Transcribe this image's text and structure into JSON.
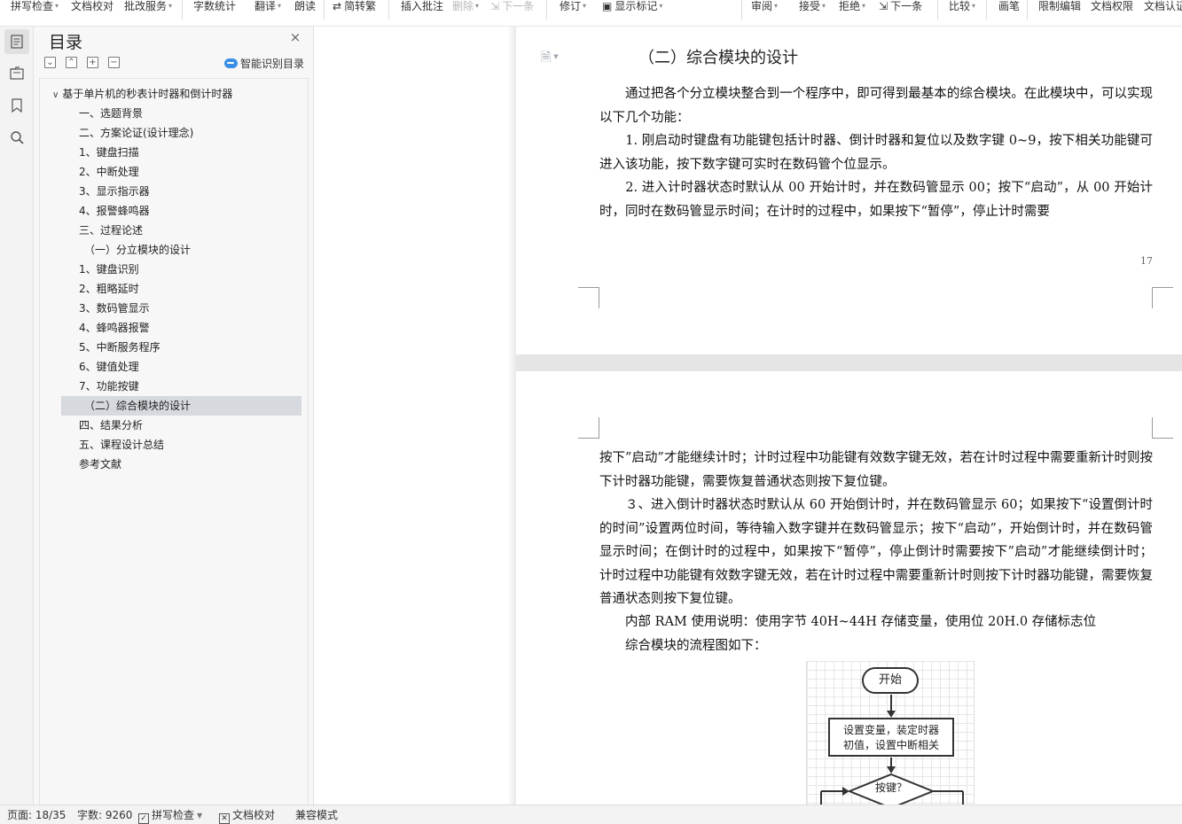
{
  "toolbar": {
    "items": [
      {
        "label": "拼写检查",
        "dropdown": true,
        "disabled": false
      },
      {
        "label": "文档校对",
        "dropdown": false,
        "disabled": false
      },
      {
        "label": "批改服务",
        "dropdown": true,
        "disabled": false
      },
      {
        "label": "字数统计",
        "dropdown": false,
        "disabled": false
      },
      {
        "label": "翻译",
        "dropdown": true,
        "disabled": false
      },
      {
        "label": "朗读",
        "dropdown": false,
        "disabled": false
      },
      {
        "label": "简转繁",
        "dropdown": false,
        "disabled": false,
        "icon": "convert-icon"
      },
      {
        "label": "插入批注",
        "dropdown": false,
        "disabled": false
      },
      {
        "label": "删除",
        "dropdown": true,
        "disabled": true
      },
      {
        "label": "下一条",
        "dropdown": false,
        "disabled": true,
        "icon": "next-comment-icon"
      },
      {
        "label": "修订",
        "dropdown": true,
        "disabled": false
      },
      {
        "label": "显示标记",
        "dropdown": true,
        "disabled": false,
        "icon": "show-markup-icon"
      },
      {
        "label": "审阅",
        "dropdown": true,
        "disabled": false
      },
      {
        "label": "接受",
        "dropdown": true,
        "disabled": false
      },
      {
        "label": "拒绝",
        "dropdown": true,
        "disabled": false
      },
      {
        "label": "下一条",
        "dropdown": false,
        "disabled": false,
        "icon": "next-change-icon"
      },
      {
        "label": "比较",
        "dropdown": true,
        "disabled": false
      },
      {
        "label": "画笔",
        "dropdown": false,
        "disabled": false
      },
      {
        "label": "限制编辑",
        "dropdown": false,
        "disabled": false
      },
      {
        "label": "文档权限",
        "dropdown": false,
        "disabled": false
      },
      {
        "label": "文档认证",
        "dropdown": false,
        "disabled": false
      }
    ]
  },
  "rail": {
    "icons": [
      "toc-icon",
      "navigation-icon",
      "bookmark-icon",
      "search-icon"
    ]
  },
  "toc": {
    "title": "目录",
    "smart_label": "智能识别目录",
    "tool_icons": [
      "collapse-icon",
      "expand-icon",
      "add-level-icon",
      "remove-level-icon"
    ],
    "root": "基于单片机的秒表计时器和倒计时器",
    "items": [
      {
        "label": "一、选题背景",
        "indent": 1
      },
      {
        "label": "二、方案论证(设计理念)",
        "indent": 1
      },
      {
        "label": "1、键盘扫描",
        "indent": 1
      },
      {
        "label": "2、中断处理",
        "indent": 1
      },
      {
        "label": "3、显示指示器",
        "indent": 1
      },
      {
        "label": "4、报警蜂鸣器",
        "indent": 1
      },
      {
        "label": "三、过程论述",
        "indent": 1
      },
      {
        "label": "（一）分立模块的设计",
        "indent": 2
      },
      {
        "label": "1、键盘识别",
        "indent": 1
      },
      {
        "label": "2、粗略延时",
        "indent": 1
      },
      {
        "label": "3、数码管显示",
        "indent": 1
      },
      {
        "label": "4、蜂鸣器报警",
        "indent": 1
      },
      {
        "label": "5、中断服务程序",
        "indent": 1
      },
      {
        "label": "6、键值处理",
        "indent": 1
      },
      {
        "label": "7、功能按键",
        "indent": 1
      },
      {
        "label": "（二）综合模块的设计",
        "indent": 2,
        "selected": true
      },
      {
        "label": "四、结果分析",
        "indent": 1
      },
      {
        "label": "五、课程设计总结",
        "indent": 1
      },
      {
        "label": "参考文献",
        "indent": 1
      }
    ]
  },
  "document": {
    "page1": {
      "heading": "（二）综合模块的设计",
      "lines": [
        "　　通过把各个分立模块整合到一个程序中，即可得到最基本的综合模块。在此模块中，可以实现以下几个功能：",
        "　　1. 刚启动时键盘有功能键包括计时器、倒计时器和复位以及数字键 0~9，按下相关功能键可进入该功能，按下数字键可实时在数码管个位显示。",
        "　　2. 进入计时器状态时默认从 00 开始计时，并在数码管显示 00；按下“启动”，从 00 开始计时，同时在数码管显示时间；在计时的过程中，如果按下“暂停”，停止计时需要"
      ],
      "page_number": "17"
    },
    "page2": {
      "lines": [
        "按下”启动”才能继续计时；计时过程中功能键有效数字键无效，若在计时过程中需要重新计时则按下计时器功能键，需要恢复普通状态则按下复位键。",
        "　　３、进入倒计时器状态时默认从 60 开始倒计时，并在数码管显示 60；如果按下“设置倒计时的时间”设置两位时间，等待输入数字键并在数码管显示；按下“启动”，开始倒计时，并在数码管显示时间；在倒计时的过程中，如果按下“暂停”，停止倒计时需要按下”启动”才能继续倒计时；计时过程中功能键有效数字键无效，若在计时过程中需要重新计时则按下计时器功能键，需要恢复普通状态则按下复位键。",
        "　　内部 RAM 使用说明：使用字节 40H~44H 存储变量，使用位 20H.0 存储标志位",
        "　　综合模块的流程图如下："
      ],
      "flowchart": {
        "start": "开始",
        "box_line1": "设置变量，装定时器",
        "box_line2": "初值，设置中断相关",
        "decision": "按键？"
      }
    }
  },
  "statusbar": {
    "page": "页面: 18/35",
    "words": "字数: 9260",
    "spell": "拼写检查",
    "proof": "文档校对",
    "compat": "兼容模式"
  },
  "colors": {
    "toc_selected": "#d6d9de",
    "page_gap": "#e5e5e5",
    "smart_icon": "#3a8ee6"
  }
}
